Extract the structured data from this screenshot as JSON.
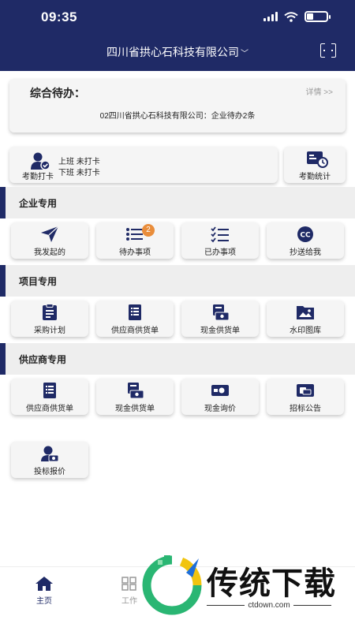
{
  "status_bar": {
    "time": "09:35"
  },
  "header": {
    "company": "四川省拱心石科技有限公司",
    "chevron": "﹀",
    "scan_icon": "scan-icon"
  },
  "todo_card": {
    "title": "综合待办：",
    "detail_link": "详情 >>",
    "summary": "02四川省拱心石科技有限公司：企业待办2条"
  },
  "attendance": {
    "label": "考勤打卡",
    "on_duty": "上班 未打卡",
    "off_duty": "下班 未打卡",
    "stats_label": "考勤统计"
  },
  "sections": {
    "enterprise": {
      "title": "企业专用",
      "items": [
        {
          "label": "我发起的",
          "icon": "send-icon"
        },
        {
          "label": "待办事项",
          "icon": "list-icon",
          "badge": "2"
        },
        {
          "label": "已办事项",
          "icon": "checklist-icon"
        },
        {
          "label": "抄送给我",
          "icon": "cc-icon"
        }
      ]
    },
    "project": {
      "title": "项目专用",
      "items": [
        {
          "label": "采购计划",
          "icon": "clipboard-icon"
        },
        {
          "label": "供应商供货单",
          "icon": "document-icon"
        },
        {
          "label": "现金供货单",
          "icon": "cash-document-icon"
        },
        {
          "label": "水印图库",
          "icon": "image-folder-icon"
        }
      ]
    },
    "supplier": {
      "title": "供应商专用",
      "items": [
        {
          "label": "供应商供货单",
          "icon": "document-icon"
        },
        {
          "label": "现金供货单",
          "icon": "cash-document-icon"
        },
        {
          "label": "现金询价",
          "icon": "cash-inquiry-icon"
        },
        {
          "label": "招标公告",
          "icon": "announcement-icon"
        },
        {
          "label": "投标报价",
          "icon": "bid-quote-icon"
        }
      ]
    }
  },
  "tabbar": {
    "items": [
      {
        "label": "主页",
        "icon": "home-icon",
        "active": true
      },
      {
        "label": "工作",
        "icon": "work-icon",
        "active": false
      }
    ]
  },
  "watermark": {
    "title": "传统下载",
    "url": "ctdown.com"
  },
  "colors": {
    "brand": "#1f2a66",
    "badge": "#e98d3b",
    "section_bg": "#eeeeee",
    "card_bg": "#f5f5f5"
  }
}
